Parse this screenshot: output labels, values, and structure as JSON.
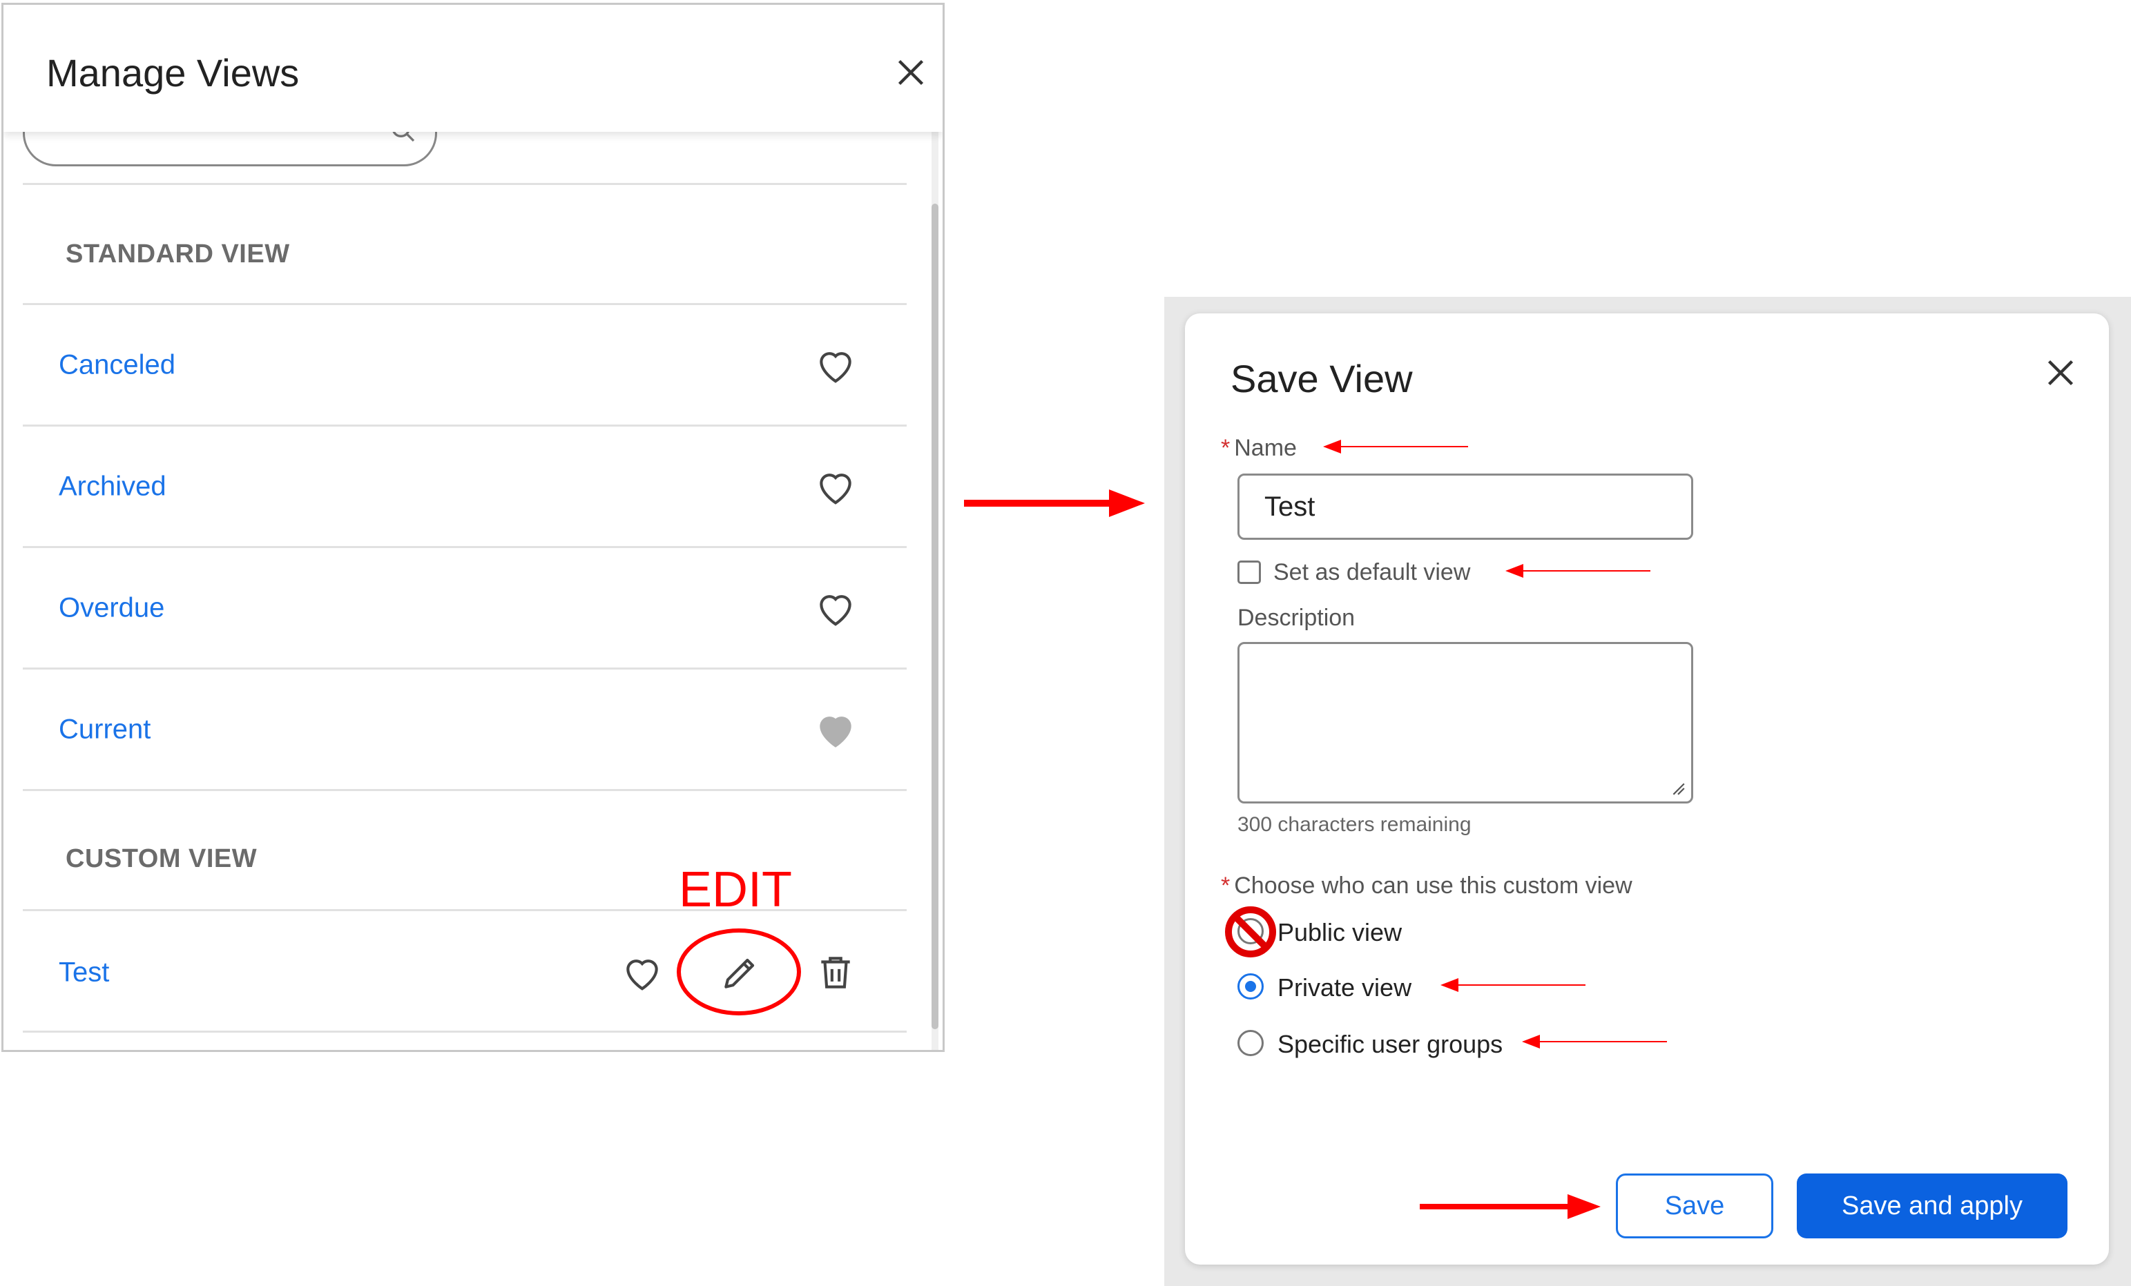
{
  "manage_views": {
    "title": "Manage Views",
    "standard_section_label": "STANDARD VIEW",
    "standard_views": [
      {
        "label": "Canceled",
        "favorite": false
      },
      {
        "label": "Archived",
        "favorite": false
      },
      {
        "label": "Overdue",
        "favorite": false
      },
      {
        "label": "Current",
        "favorite": true
      }
    ],
    "custom_section_label": "CUSTOM VIEW",
    "custom_views": [
      {
        "label": "Test",
        "favorite": false
      }
    ],
    "edit_annotation": "EDIT"
  },
  "save_view": {
    "title": "Save View",
    "name_label": "Name",
    "name_value": "Test",
    "default_checkbox_label": "Set as default view",
    "description_label": "Description",
    "description_value": "",
    "chars_remaining": "300 characters remaining",
    "visibility_label": "Choose who can use this custom view",
    "visibility_options": [
      {
        "label": "Public view",
        "selected": false
      },
      {
        "label": "Private view",
        "selected": true
      },
      {
        "label": "Specific user groups",
        "selected": false
      }
    ],
    "save_button": "Save",
    "save_apply_button": "Save and apply"
  },
  "colors": {
    "link_blue": "#1a73e8",
    "primary_button": "#0b62e0",
    "annotation_red": "#ff0000",
    "favorite_filled": "#b0b0b0"
  }
}
